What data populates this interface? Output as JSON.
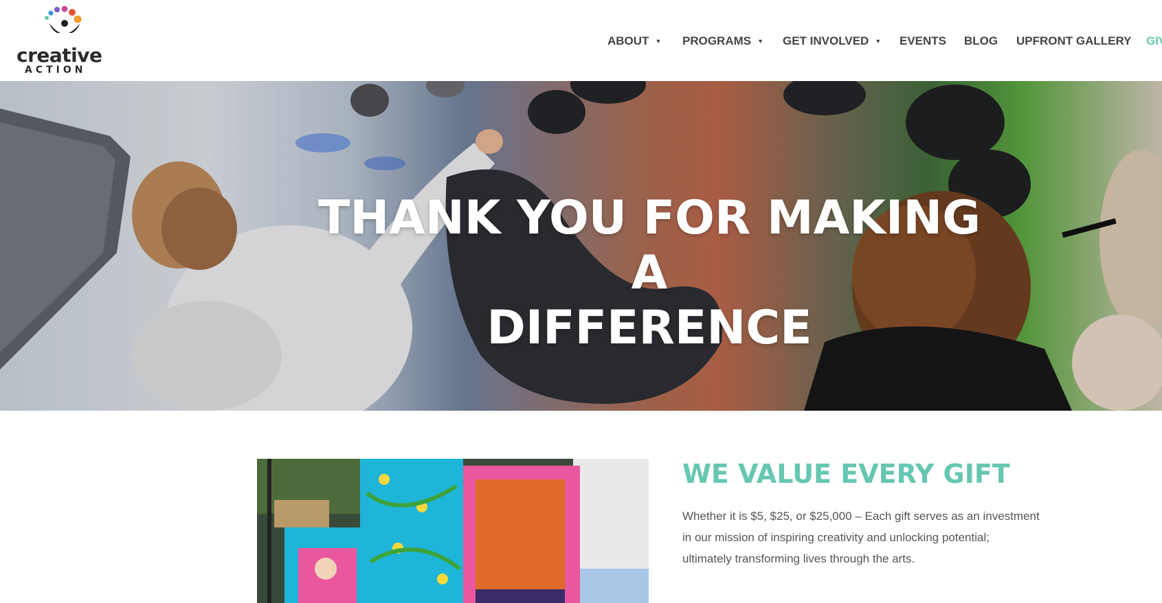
{
  "brand": {
    "name_line1": "creative",
    "name_line2": "ACTION",
    "dot_colors": [
      "#66c7b1",
      "#3b8fd6",
      "#7b5bc4",
      "#c74a9a",
      "#e8523a",
      "#f39a2c"
    ]
  },
  "nav": {
    "items": [
      {
        "label": "ABOUT",
        "caret": "▼"
      },
      {
        "label": "PROGRAMS",
        "caret": "▼"
      },
      {
        "label": "GET INVOLVED",
        "caret": "▼"
      },
      {
        "label": "EVENTS"
      },
      {
        "label": "BLOG"
      },
      {
        "label": "UPFRONT GALLERY"
      },
      {
        "label": "GIV"
      }
    ]
  },
  "hero": {
    "title_line1": "THANK YOU FOR MAKING A",
    "title_line2": "DIFFERENCE"
  },
  "section": {
    "heading": "WE VALUE EVERY GIFT",
    "body": "Whether it is $5, $25, or $25,000 – Each gift serves as an investment in our mission of inspiring creativity and unlocking potential; ultimately transforming lives through the arts."
  },
  "colors": {
    "accent": "#66c7b1",
    "nav_text": "#444444",
    "body_text": "#555555"
  }
}
